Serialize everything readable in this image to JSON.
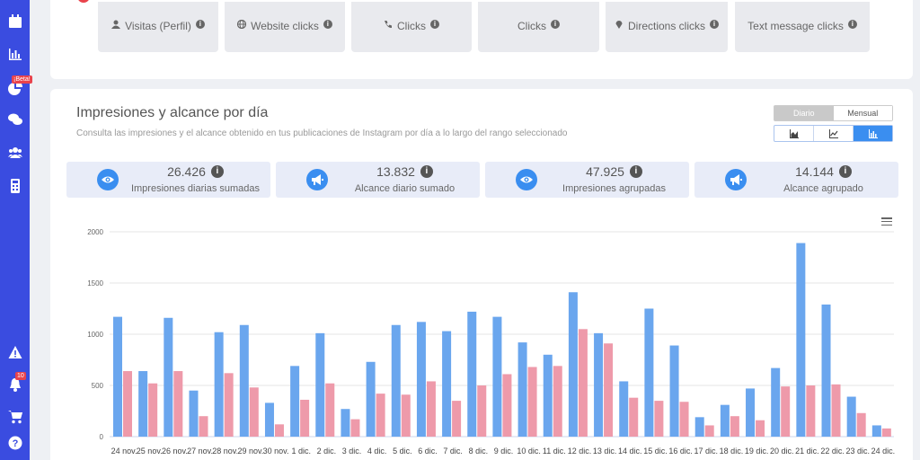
{
  "sidebar": {
    "beta_badge": "¡Beta!",
    "notifications_badge": "10",
    "icons": [
      "calendar-icon",
      "bar-chart-icon",
      "pie-chart-icon",
      "chat-icon",
      "users-icon",
      "calculator-icon",
      "warning-icon",
      "bell-icon",
      "cart-icon",
      "help-icon"
    ]
  },
  "top_tabs": [
    {
      "label": "Visitas (Perfil)",
      "icon": "user-icon"
    },
    {
      "label": "Website clicks",
      "icon": "globe-icon"
    },
    {
      "label": "Clicks",
      "icon": "phone-icon"
    },
    {
      "label": "Clicks",
      "icon": ""
    },
    {
      "label": "Directions clicks",
      "icon": "pin-icon"
    },
    {
      "label": "Text message clicks",
      "icon": ""
    }
  ],
  "section": {
    "title": "Impresiones y alcance por día",
    "subtitle": "Consulta las impresiones y el alcance obtenido en tus publicaciones de Instagram por día a lo largo del rango seleccionado",
    "toggle": {
      "daily": "Diario",
      "monthly": "Mensual"
    }
  },
  "stats": [
    {
      "value": "26.426",
      "label": "Impresiones diarias sumadas",
      "icon": "eye-icon"
    },
    {
      "value": "13.832",
      "label": "Alcance diario sumado",
      "icon": "megaphone-icon"
    },
    {
      "value": "47.925",
      "label": "Impresiones agrupadas",
      "icon": "eye-icon"
    },
    {
      "value": "14.144",
      "label": "Alcance agrupado",
      "icon": "megaphone-icon"
    }
  ],
  "colors": {
    "accent": "#3a4ce0",
    "impressions": "#6aa6ee",
    "reach": "#ee9aaa",
    "highlight": "#3a8ef0"
  },
  "chart_data": {
    "type": "bar",
    "categories": [
      "24 nov.",
      "25 nov.",
      "26 nov.",
      "27 nov.",
      "28 nov.",
      "29 nov.",
      "30 nov.",
      "1 dic.",
      "2 dic.",
      "3 dic.",
      "4 dic.",
      "5 dic.",
      "6 dic.",
      "7 dic.",
      "8 dic.",
      "9 dic.",
      "10 dic.",
      "11 dic.",
      "12 dic.",
      "13 dic.",
      "14 dic.",
      "15 dic.",
      "16 dic.",
      "17 dic.",
      "18 dic.",
      "19 dic.",
      "20 dic.",
      "21 dic.",
      "22 dic.",
      "23 dic.",
      "24 dic."
    ],
    "series": [
      {
        "values": [
          1170,
          640,
          1160,
          450,
          1020,
          1090,
          330,
          690,
          1010,
          270,
          730,
          1090,
          1120,
          1030,
          1220,
          1170,
          920,
          800,
          1410,
          1010,
          540,
          1250,
          890,
          190,
          310,
          470,
          670,
          1890,
          1290,
          390,
          110
        ]
      },
      {
        "values": [
          640,
          520,
          640,
          200,
          620,
          480,
          120,
          360,
          520,
          170,
          420,
          410,
          540,
          350,
          500,
          610,
          680,
          690,
          1050,
          910,
          380,
          350,
          340,
          110,
          200,
          160,
          490,
          500,
          510,
          230,
          80
        ]
      }
    ],
    "yticks": [
      "0",
      "500",
      "1000",
      "1500",
      "2000"
    ],
    "ylim": [
      0,
      2000
    ],
    "grid": true
  }
}
